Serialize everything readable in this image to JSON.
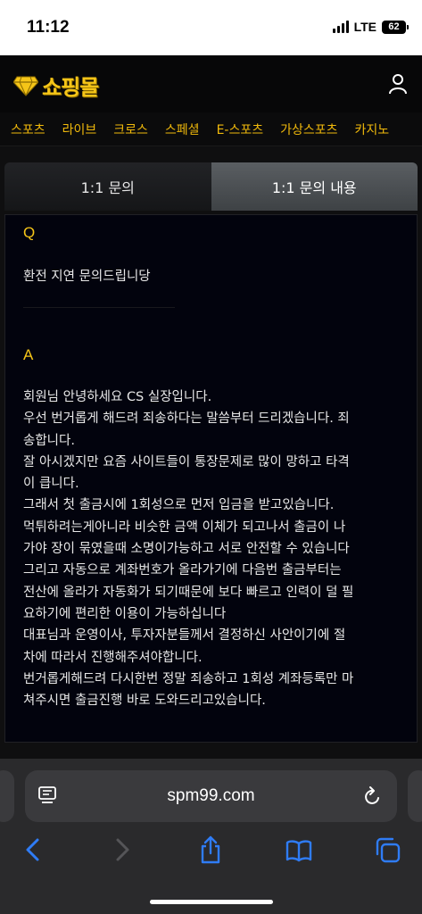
{
  "status_bar": {
    "time": "11:12",
    "network": "LTE",
    "battery": "62"
  },
  "header": {
    "logo_text": "쇼핑몰",
    "logo_icon": "diamond-icon",
    "user_icon": "user-icon"
  },
  "nav": {
    "items": [
      "스포츠",
      "라이브",
      "크로스",
      "스페셜",
      "E-스포츠",
      "가상스포츠",
      "카지노"
    ]
  },
  "tabs": [
    {
      "label": "1:1 문의",
      "active": false
    },
    {
      "label": "1:1 문의 내용",
      "active": true
    }
  ],
  "inquiry": {
    "q_label": "Q",
    "question": "환전 지연 문의드립니당",
    "a_label": "A",
    "answer_lines": [
      "회원님 안녕하세요 CS 실장입니다.",
      "우선 번거롭게 해드려 죄송하다는 말씀부터 드리겠습니다. 죄",
      "송합니다.",
      "잘 아시겠지만 요즘 사이트들이 통장문제로 많이 망하고 타격",
      "이 큽니다.",
      "그래서 첫 출금시에 1회성으로 먼저 입금을 받고있습니다.",
      "먹튀하려는게아니라 비슷한 금액 이체가 되고나서 출금이 나",
      "가야 장이 묶였을때 소명이가능하고 서로 안전할 수 있습니다",
      "그리고 자동으로 계좌번호가 올라가기에 다음번 출금부터는",
      "전산에 올라가 자동화가 되기때문에 보다 빠르고 인력이 덜 필",
      "요하기에 편리한 이용이 가능하십니다",
      "대표님과 운영이사, 투자자분들께서 결정하신 사안이기에 절",
      "차에 따라서 진행해주셔야합니다.",
      "번거롭게해드려 다시한번 정말 죄송하고 1회성 계좌등록만 마",
      "쳐주시면 출금진행 바로 도와드리고있습니다."
    ]
  },
  "browser": {
    "url": "spm99.com",
    "icons": [
      "reader-icon",
      "reload-icon",
      "back-icon",
      "forward-icon",
      "share-icon",
      "bookmarks-icon",
      "tabs-icon"
    ]
  },
  "colors": {
    "accent": "#f5c518",
    "nav_text": "#f0b90b",
    "browser_blue": "#2f7cf6"
  }
}
